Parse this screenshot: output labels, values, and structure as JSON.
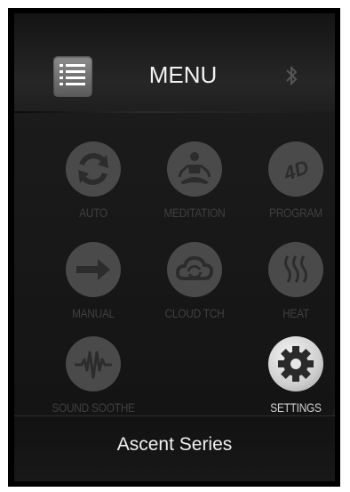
{
  "header": {
    "title": "MENU",
    "menu_icon": "list-icon",
    "bluetooth_icon": "bluetooth-icon"
  },
  "tiles": [
    {
      "label": "AUTO",
      "icon": "refresh-icon",
      "active": false
    },
    {
      "label": "MEDITATION",
      "icon": "meditation-icon",
      "active": false
    },
    {
      "label": "PROGRAM",
      "icon": "program-4d-icon",
      "active": false
    },
    {
      "label": "MANUAL",
      "icon": "arrow-right-icon",
      "active": false
    },
    {
      "label": "CLOUD TCH",
      "icon": "cloud-icon",
      "active": false
    },
    {
      "label": "HEAT",
      "icon": "heat-icon",
      "active": false
    },
    {
      "label": "SOUND SOOTHE",
      "icon": "soundwave-icon",
      "active": false
    },
    {
      "label": "SETTINGS",
      "icon": "gear-icon",
      "active": true
    }
  ],
  "footer": {
    "text": "Ascent Series"
  },
  "colors": {
    "icon_inactive": "#4a4a4a",
    "label_inactive": "#3f3f3f",
    "active_label": "#d0d0d0"
  }
}
